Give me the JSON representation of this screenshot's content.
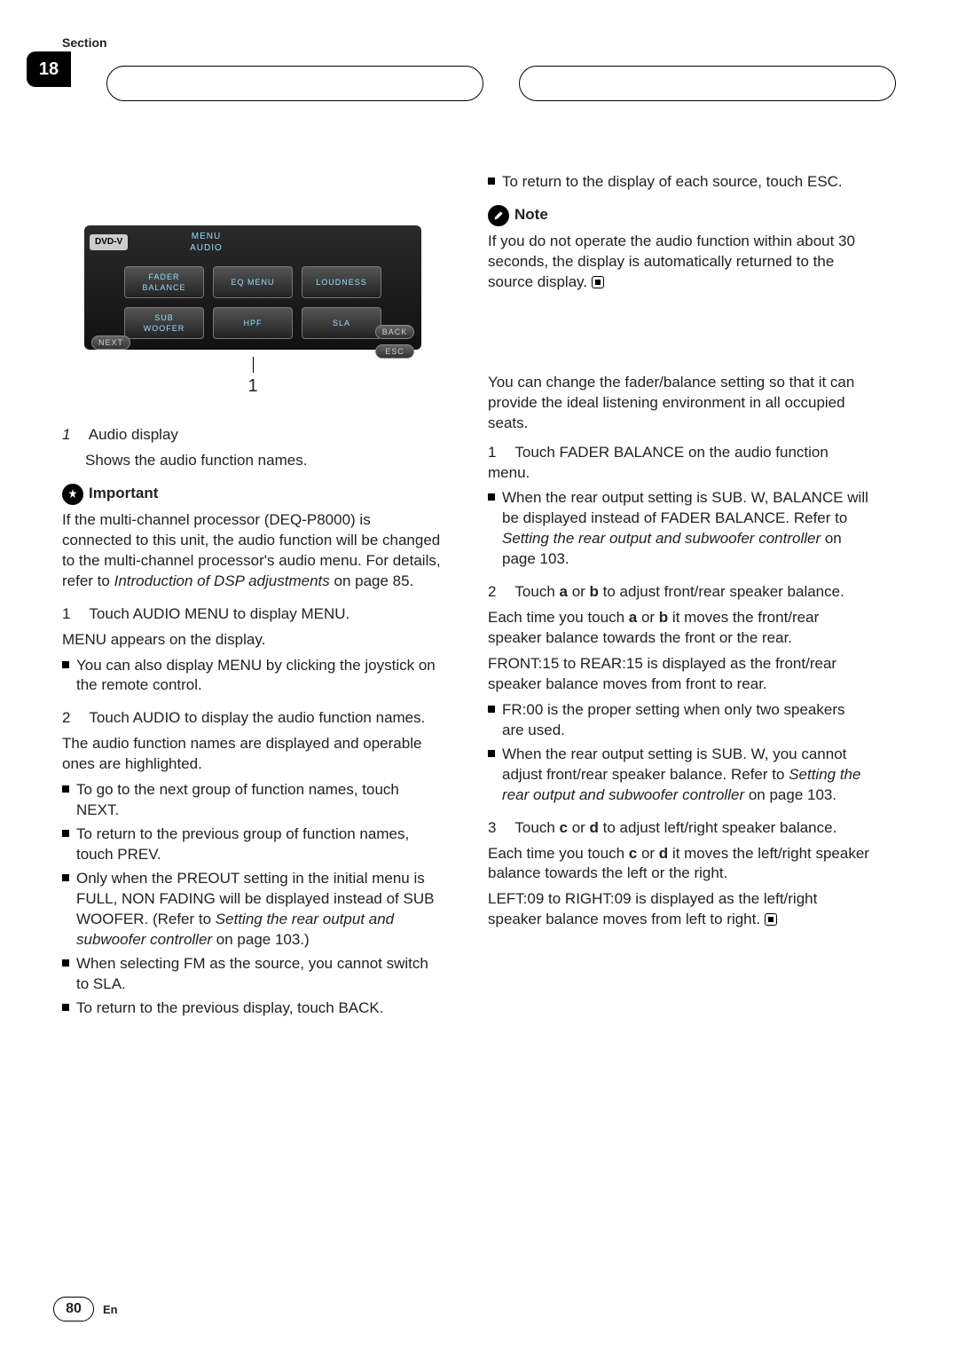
{
  "header": {
    "section_label": "Section",
    "section_number": "18"
  },
  "screenshot": {
    "dvd_label": "DVD-V",
    "menu_line1": "MENU",
    "menu_line2": "AUDIO",
    "row1": [
      "FADER\nBALANCE",
      "EQ MENU",
      "LOUDNESS"
    ],
    "row2": [
      "SUB\nWOOFER",
      "HPF",
      "SLA"
    ],
    "next": "NEXT",
    "back": "BACK",
    "esc": "ESC",
    "callout_number": "1"
  },
  "left": {
    "caption_num": "1",
    "caption_title": "Audio display",
    "caption_desc": "Shows the audio function names.",
    "important_label": "Important",
    "important_text1": "If the multi-channel processor (DEQ-P8000) is connected to this unit, the audio function will be changed to the multi-channel processor's audio menu. For details, refer to ",
    "important_ref": "Introduction of DSP adjustments",
    "important_text2": " on page 85.",
    "step1_num": "1",
    "step1": "Touch AUDIO MENU to display MENU.",
    "step1_sub": "MENU appears on the display.",
    "step1_bullet": "You can also display MENU by clicking the joystick on the remote control.",
    "step2_num": "2",
    "step2": "Touch AUDIO to display the audio function names.",
    "step2_sub": "The audio function names are displayed and operable ones are highlighted.",
    "b_next": "To go to the next group of function names, touch NEXT.",
    "b_prev": "To return to the previous group of function names, touch PREV.",
    "b_preout1": "Only when the PREOUT setting in the initial menu is FULL, NON FADING will be displayed instead of SUB WOOFER. (Refer to ",
    "b_preout_ref": "Setting the rear output and subwoofer controller",
    "b_preout2": " on page 103.)",
    "b_fm": "When selecting FM as the source, you cannot switch to SLA.",
    "b_back": "To return to the previous display, touch BACK."
  },
  "right": {
    "b_esc": "To return to the display of each source, touch ESC.",
    "note_label": "Note",
    "note_text": "If you do not operate the audio function within about 30 seconds, the display is automatically returned to the source display.",
    "intro": "You can change the fader/balance setting so that it can provide the ideal listening environment in all occupied seats.",
    "s1_num": "1",
    "s1": "Touch FADER BALANCE on the audio function menu.",
    "s1_b1": "When the rear output setting is SUB. W, BALANCE will be displayed instead of FADER BALANCE. Refer to ",
    "s1_ref": "Setting the rear output and subwoofer controller",
    "s1_b2": " on page 103.",
    "s2_num": "2",
    "s2_a": "Touch ",
    "s2_b": " or ",
    "s2_c": " to adjust front/rear speaker balance.",
    "s2_sub_a": "Each time you touch ",
    "s2_sub_b": " or ",
    "s2_sub_c": " it moves the front/rear speaker balance towards the front or the rear.",
    "s2_range": "FRONT:15 to REAR:15 is displayed as the front/rear speaker balance moves from front to rear.",
    "s2_b1": "FR:00 is the proper setting when only two speakers are used.",
    "s2_b2a": "When the rear output setting is SUB. W, you cannot adjust front/rear speaker balance. Refer to ",
    "s2_b2ref": "Setting the rear output and subwoofer controller",
    "s2_b2b": " on page 103.",
    "s3_num": "3",
    "s3_a": "Touch ",
    "s3_b": " or ",
    "s3_c": " to adjust left/right speaker balance.",
    "s3_sub_a": "Each time you touch ",
    "s3_sub_b": " or ",
    "s3_sub_c": " it moves the left/right speaker balance towards the left or the right.",
    "s3_range": "LEFT:09 to RIGHT:09 is displayed as the left/right speaker balance moves from left to right.",
    "letters": {
      "a": "a",
      "b": "b",
      "c": "c",
      "d": "d"
    }
  },
  "footer": {
    "page": "80",
    "lang": "En"
  }
}
